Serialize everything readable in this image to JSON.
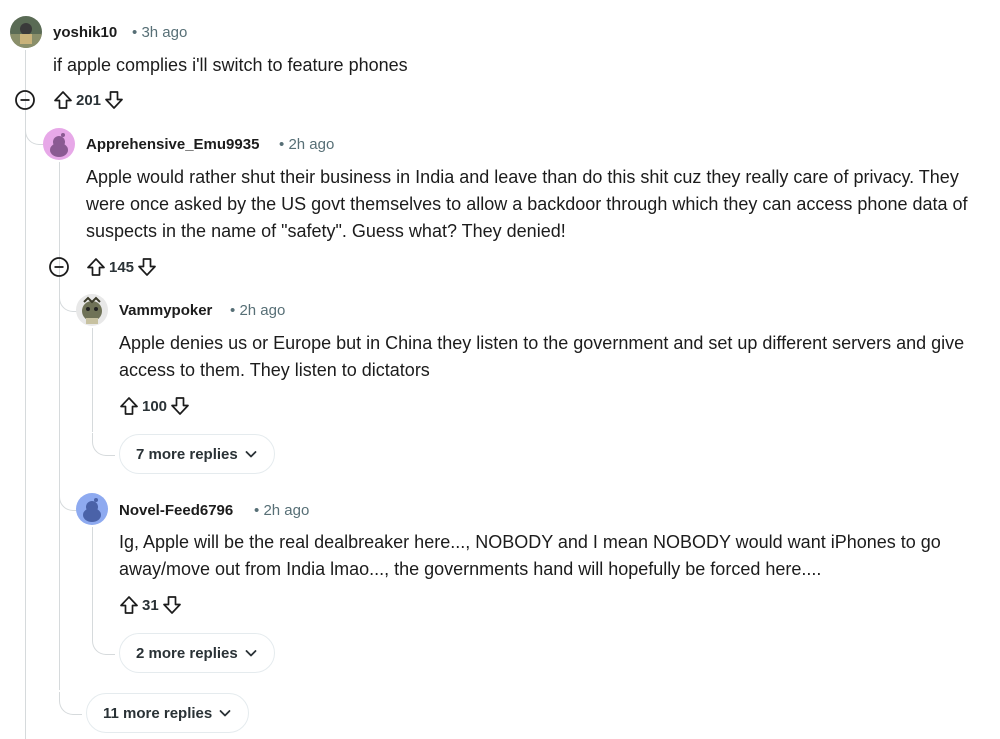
{
  "comments": {
    "root": {
      "author": "yoshik10",
      "time": "3h ago",
      "text": "if apple complies i'll switch to feature phones",
      "score": "201"
    },
    "reply1": {
      "author": "Apprehensive_Emu9935",
      "time": "2h ago",
      "text": "Apple would rather shut their business in India and leave than do this shit cuz they really care of privacy. They were once asked by the US govt themselves to allow a backdoor through which they can access phone data of suspects in the name of \"safety\". Guess what? They denied!",
      "score": "145"
    },
    "reply1a": {
      "author": "Vammypoker",
      "time": "2h ago",
      "text": "Apple denies us or Europe but in China they listen to the government and set up different servers and give access to them. They listen to dictators",
      "score": "100",
      "more_replies": "7 more replies"
    },
    "reply1b": {
      "author": "Novel-Feed6796",
      "time": "2h ago",
      "text": "Ig, Apple will be the real dealbreaker here..., NOBODY and I mean NOBODY would want iPhones to go away/move out from India lmao..., the governments hand will hopefully be forced here....",
      "score": "31",
      "more_replies": "2 more replies"
    },
    "root_more_replies": "11 more replies"
  },
  "separator": "•",
  "colors": {
    "text": "#1c1c1c",
    "meta": "#576f76",
    "thread_line": "#d6dadc",
    "snoo_pink_bg": "#e7a8e8",
    "snoo_blue_bg": "#8eaaf0"
  },
  "icons": {
    "upvote": "arrow-up-outline-icon",
    "downvote": "arrow-down-outline-icon",
    "collapse": "minus-circle-icon",
    "expand": "chevron-down-icon"
  }
}
